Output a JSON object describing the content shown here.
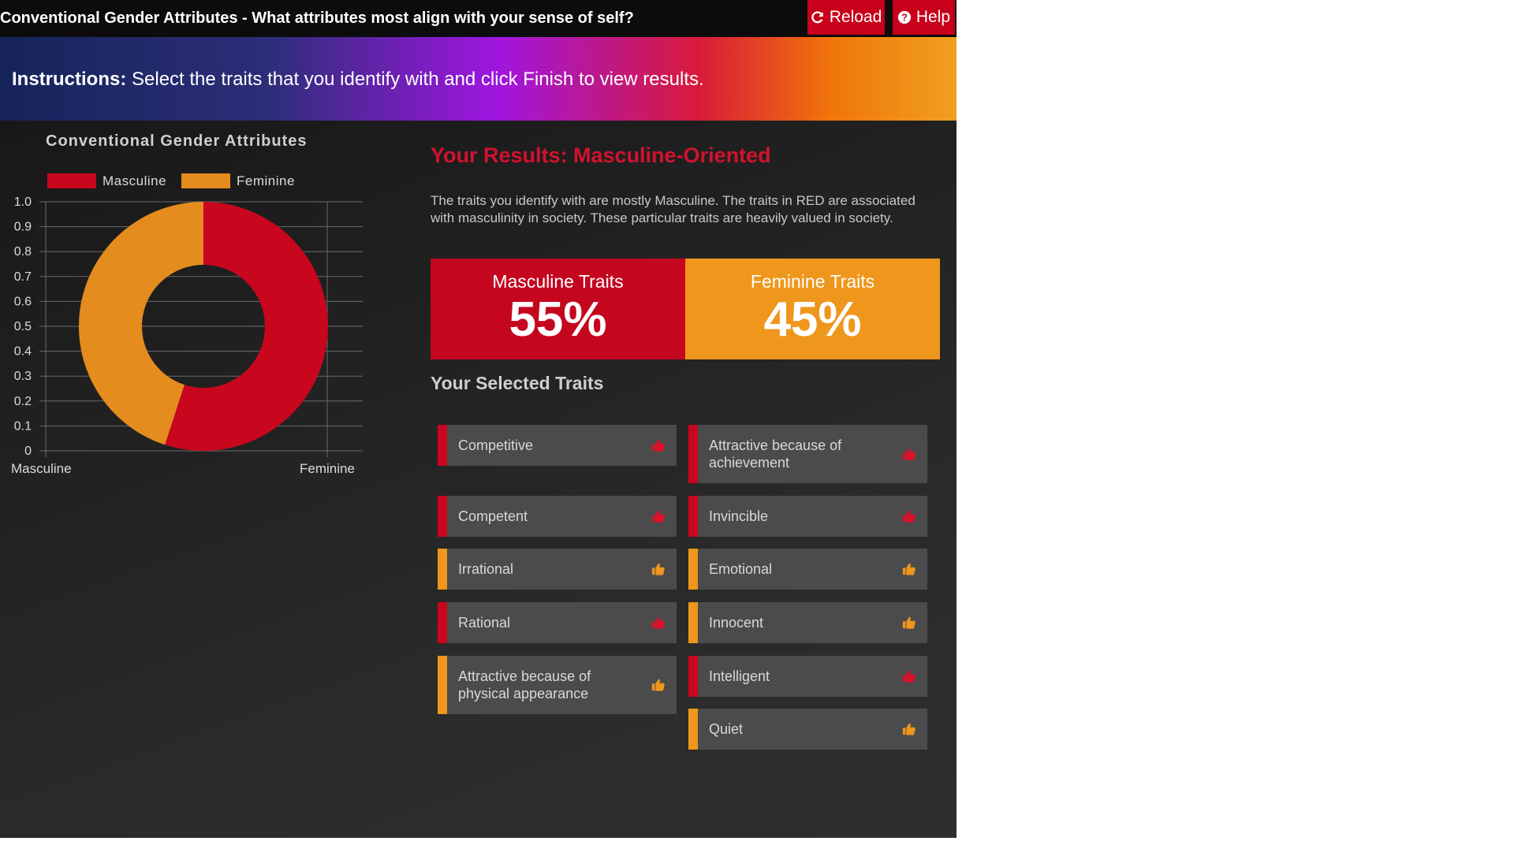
{
  "header": {
    "title": "Conventional Gender Attributes - What attributes most align with your sense of self?",
    "reload_label": "Reload",
    "help_label": "Help"
  },
  "instructions": {
    "label": "Instructions:",
    "text": " Select the traits that you identify with and click Finish to view results."
  },
  "colors": {
    "masculine": "#c8061e",
    "feminine": "#e48c1e"
  },
  "chart_data": {
    "type": "pie",
    "title": "Conventional Gender Attributes",
    "legend": [
      "Masculine",
      "Feminine"
    ],
    "legend_position": "top",
    "slices": [
      {
        "name": "Masculine",
        "value": 55
      },
      {
        "name": "Feminine",
        "value": 45
      }
    ],
    "donut": true,
    "categories": [
      "Masculine",
      "Feminine"
    ],
    "y_ticks": [
      "1.0",
      "0.9",
      "0.8",
      "0.7",
      "0.6",
      "0.5",
      "0.4",
      "0.3",
      "0.2",
      "0.1",
      "0"
    ],
    "ylim": [
      0,
      1
    ],
    "grid": true
  },
  "results": {
    "heading": "Your Results: Masculine-Oriented",
    "description": "The traits you identify with are mostly Masculine. The traits in RED are associated with masculinity in society. These particular traits are heavily valued in society.",
    "masculine_label": "Masculine Traits",
    "masculine_pct": "55%",
    "feminine_label": "Feminine Traits",
    "feminine_pct": "45%"
  },
  "traits_heading": "Your Selected Traits",
  "traits_left": [
    {
      "label": "Competitive",
      "type": "masculine"
    },
    {
      "label": "Competent",
      "type": "masculine"
    },
    {
      "label": "Irrational",
      "type": "feminine"
    },
    {
      "label": "Rational",
      "type": "masculine"
    },
    {
      "label": "Attractive because of physical appearance",
      "type": "feminine"
    }
  ],
  "traits_right": [
    {
      "label": "Attractive because of achievement",
      "type": "masculine"
    },
    {
      "label": "Invincible",
      "type": "masculine"
    },
    {
      "label": "Emotional",
      "type": "feminine"
    },
    {
      "label": "Innocent",
      "type": "feminine"
    },
    {
      "label": "Intelligent",
      "type": "masculine"
    },
    {
      "label": "Quiet",
      "type": "feminine"
    }
  ],
  "icons": {
    "reload": "refresh-icon",
    "help": "question-circle-icon",
    "trait": "thumbs-up-icon"
  }
}
